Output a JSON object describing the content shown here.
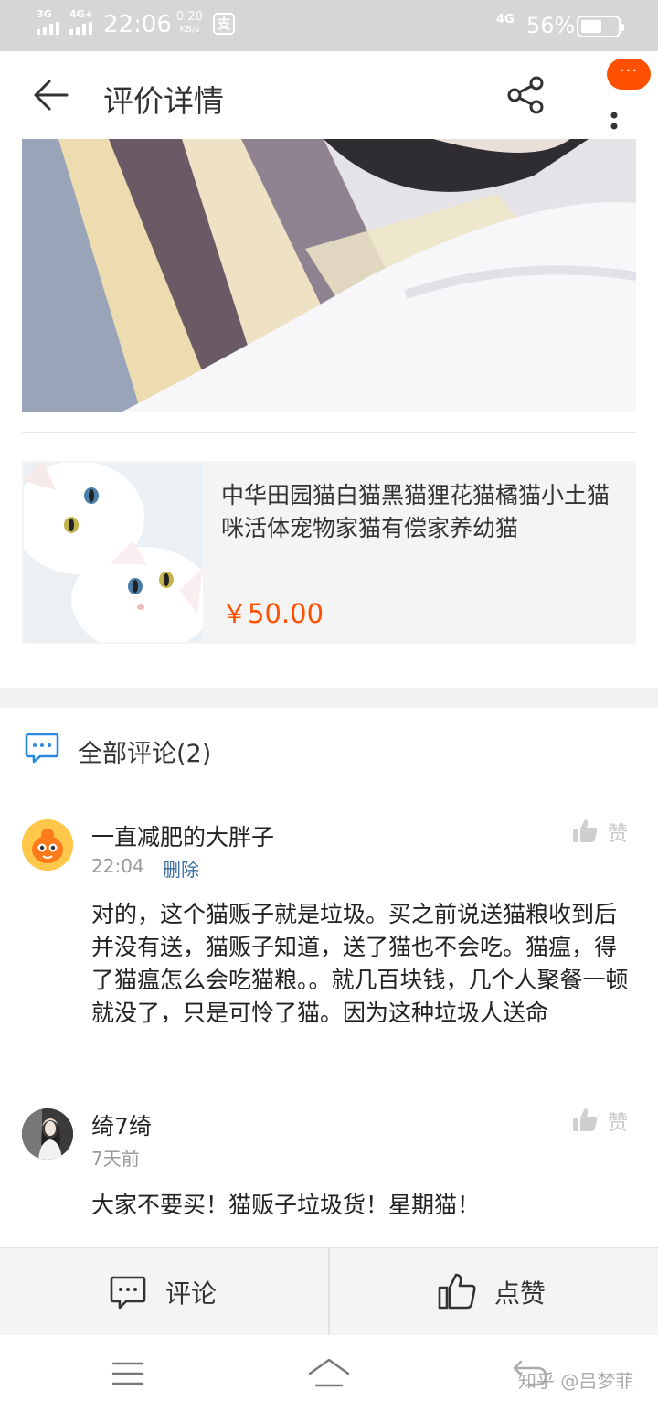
{
  "status_bar": {
    "network1": "3G",
    "network2": "4G+",
    "time": "22:06",
    "speed_value": "0.20",
    "speed_unit": "KB/s",
    "pay_icon_text": "支",
    "network3": "4G",
    "battery": "56%"
  },
  "header": {
    "title": "评价详情",
    "more_badge": "···"
  },
  "product": {
    "title": "中华田园猫白猫黑猫狸花猫橘猫小土猫咪活体宠物家猫有偿家养幼猫",
    "price": "￥50.00"
  },
  "comments": {
    "section_title": "全部评论(2)",
    "items": [
      {
        "user": "一直减肥的大胖子",
        "time": "22:04",
        "delete_label": "删除",
        "like_label": "赞",
        "text": "对的，这个猫贩子就是垃圾。买之前说送猫粮收到后并没有送，猫贩子知道，送了猫也不会吃。猫瘟，得了猫瘟怎么会吃猫粮。。就几百块钱，几个人聚餐一顿就没了，只是可怜了猫。因为这种垃圾人送命"
      },
      {
        "user": "绮7绮",
        "time": "7天前",
        "like_label": "赞",
        "text": "大家不要买！猫贩子垃圾货！星期猫！"
      }
    ]
  },
  "bottom_bar": {
    "comment_label": "评论",
    "like_label": "点赞"
  },
  "watermark": "知乎 @吕梦菲",
  "colors": {
    "accent": "#ff5000",
    "link": "#3a6ea5",
    "icon_blue": "#2a8ae0"
  }
}
